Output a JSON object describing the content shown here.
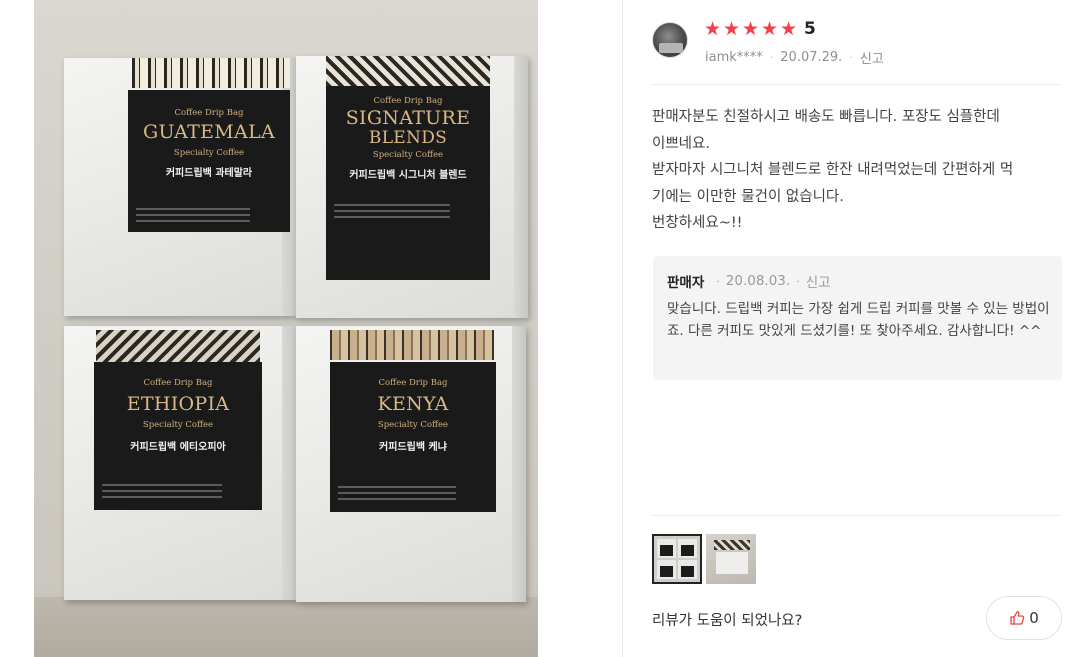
{
  "photo": {
    "boxes": [
      {
        "header": "Coffee Drip Bag",
        "name": "GUATEMALA",
        "specialty": "Specialty Coffee",
        "korean": "커피드립백 과테말라"
      },
      {
        "header": "Coffee Drip Bag",
        "name_line1": "SIGNATURE",
        "name_line2": "BLENDS",
        "specialty": "Specialty Coffee",
        "korean": "커피드립백 시그니처 블렌드"
      },
      {
        "header": "Coffee Drip Bag",
        "name": "ETHIOPIA",
        "specialty": "Specialty Coffee",
        "korean": "커피드립백 에티오피아"
      },
      {
        "header": "Coffee Drip Bag",
        "name": "KENYA",
        "specialty": "Specialty Coffee",
        "korean": "커피드립백 케냐"
      }
    ]
  },
  "review": {
    "rating": 5,
    "rating_text": "5",
    "stars": [
      "★",
      "★",
      "★",
      "★",
      "★"
    ],
    "star_color": "#f1404b",
    "username": "iamk****",
    "date": "20.07.29.",
    "report_label": "신고",
    "body": "판매자분도 친절하시고 배송도 빠릅니다. 포장도 심플한데\n이쁘네요.\n받자마자 시그니처 블렌드로 한잔 내려먹었는데 간편하게 먹\n기에는 이만한 물건이 없습니다.\n번창하세요~!!"
  },
  "seller_reply": {
    "author": "판매자",
    "date": "20.08.03.",
    "report_label": "신고",
    "body": "맞습니다. 드립백 커피는 가장 쉽게 드립 커피를 맛볼 수 있는 방법이죠. 다른 커피도 맛있게 드셨기를! 또 찾아주세요. 감사합니다! ^^"
  },
  "footer": {
    "helpful_question": "리뷰가 도움이 되었나요?",
    "helpful_count": "0",
    "icon": "thumbs-up-icon"
  }
}
